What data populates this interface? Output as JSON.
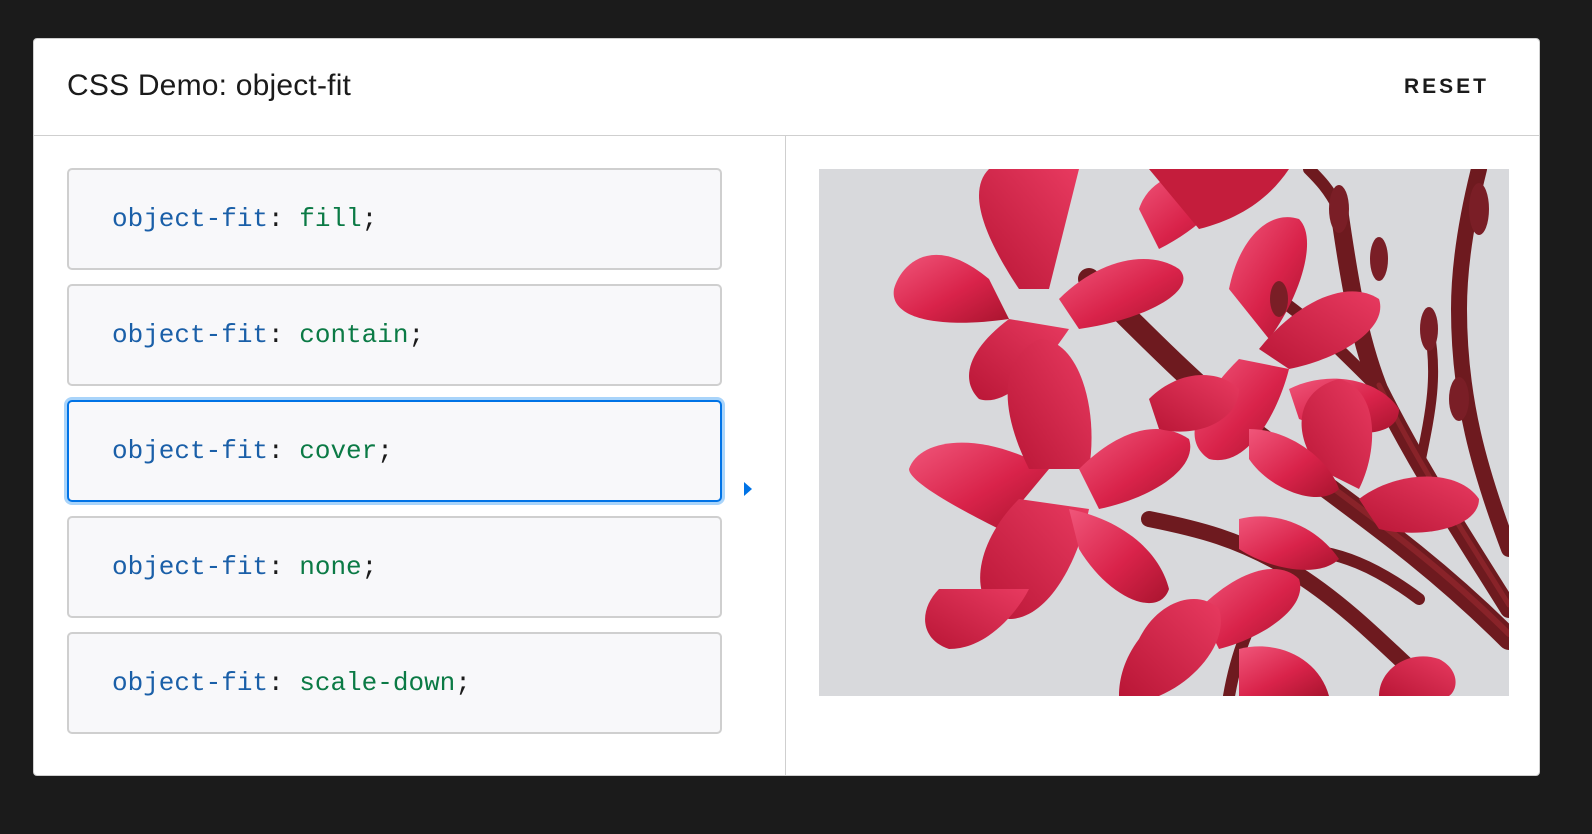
{
  "header": {
    "title": "CSS Demo: object-fit",
    "reset_label": "RESET"
  },
  "options": [
    {
      "property": "object-fit",
      "colon": ":",
      "value": "fill",
      "semi": ";"
    },
    {
      "property": "object-fit",
      "colon": ":",
      "value": "contain",
      "semi": ";"
    },
    {
      "property": "object-fit",
      "colon": ":",
      "value": "cover",
      "semi": ";"
    },
    {
      "property": "object-fit",
      "colon": ":",
      "value": "none",
      "semi": ";"
    },
    {
      "property": "object-fit",
      "colon": ":",
      "value": "scale-down",
      "semi": ";"
    }
  ],
  "selected_option": "cover",
  "colors": {
    "property": "#1a5fa8",
    "value": "#0b7a45",
    "selected_border": "#0073e6",
    "selected_glow": "#a9d4fa",
    "page_background": "#1b1b1b"
  },
  "preview": {
    "icon": "flower-photo"
  }
}
